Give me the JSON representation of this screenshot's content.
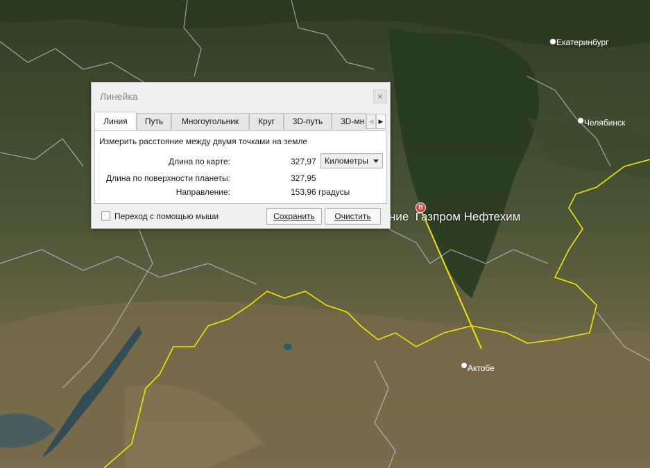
{
  "map": {
    "cities": [
      {
        "name": "Екатеринбург"
      },
      {
        "name": "Челябинск"
      },
      {
        "name": "Актобе"
      }
    ],
    "poi_label": "ние  Газпром Нефтехим",
    "pin_letter": "B",
    "colors": {
      "ruler_line": "#f2e600",
      "boundary": "#f2e600",
      "admin_lines": "#c8cde6",
      "pin": "#e03b3b"
    }
  },
  "dialog": {
    "title": "Линейка",
    "close_icon": "×",
    "tabs": [
      {
        "label": "Линия",
        "active": true
      },
      {
        "label": "Путь"
      },
      {
        "label": "Многоугольник"
      },
      {
        "label": "Круг"
      },
      {
        "label": "3D-путь"
      },
      {
        "label": "3D-мн"
      }
    ],
    "tab_scroll_left": "◀",
    "tab_scroll_right": "▶",
    "description": "Измерить расстояние между двумя точками на земле",
    "map_length_label": "Длина по карте:",
    "map_length_value": "327,97",
    "unit": "Километры",
    "surface_length_label": "Длина по поверхности планеты:",
    "surface_length_value": "327,95",
    "heading_label": "Направление:",
    "heading_value": "153,96 градусы",
    "mouse_nav_label": "Переход с помощью мыши",
    "mouse_nav_checked": false,
    "save_label": "Сохранить",
    "clear_label": "Очистить"
  }
}
